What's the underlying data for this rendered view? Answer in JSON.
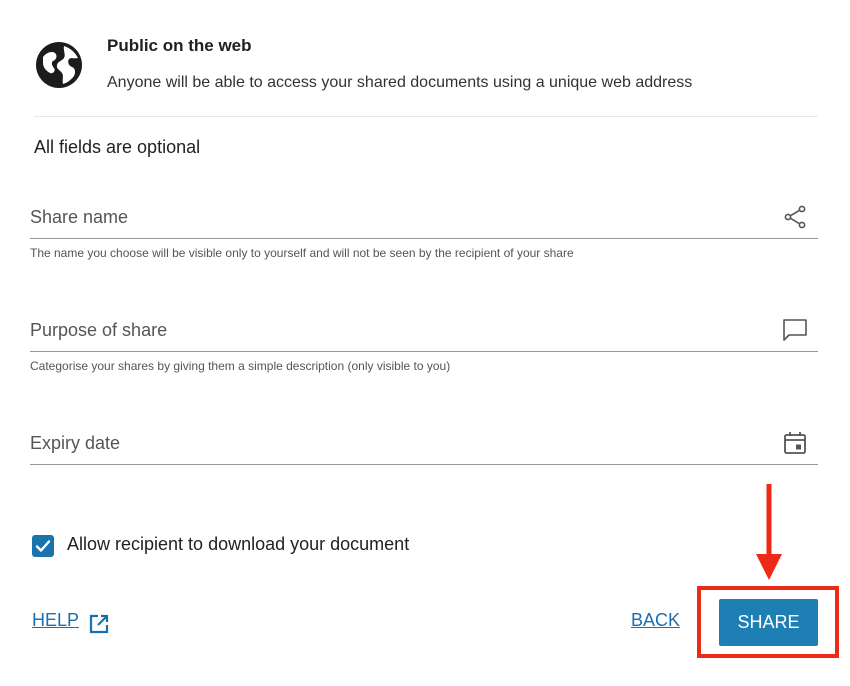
{
  "header": {
    "title": "Public on the web",
    "description": "Anyone will be able to access your shared documents using a unique web address",
    "icon": "globe-icon"
  },
  "form": {
    "optional_note": "All fields are optional",
    "share_name": {
      "value": "",
      "placeholder": "Share name",
      "hint": "The name you choose will be visible only to yourself and will not be seen by the recipient of your share",
      "icon": "share-icon"
    },
    "purpose": {
      "value": "",
      "placeholder": "Purpose of share",
      "hint": "Categorise your shares by giving them a simple description (only visible to you)",
      "icon": "comment-icon"
    },
    "expiry": {
      "value": "",
      "placeholder": "Expiry date",
      "icon": "calendar-icon"
    },
    "allow_download": {
      "label": "Allow recipient to download your document",
      "checked": true
    }
  },
  "footer": {
    "help_label": "HELP",
    "back_label": "BACK",
    "share_label": "SHARE"
  },
  "colors": {
    "accent": "#1e7fb5",
    "link": "#1a6fb0",
    "annotation": "#ee2a16"
  }
}
